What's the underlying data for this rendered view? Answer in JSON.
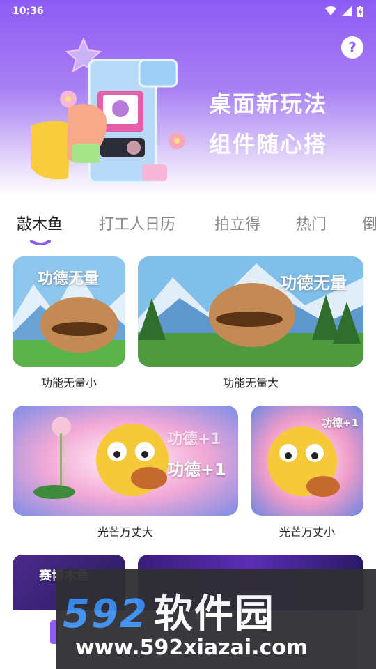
{
  "status_bar": {
    "time": "10:36"
  },
  "hero": {
    "line1": "桌面新玩法",
    "line2": "组件随心搭",
    "help": "?"
  },
  "tabs": [
    {
      "label": "敲木鱼",
      "active": true
    },
    {
      "label": "打工人日历"
    },
    {
      "label": "拍立得"
    },
    {
      "label": "热门"
    },
    {
      "label": "倒"
    }
  ],
  "cards": [
    {
      "caption": "功能无量小",
      "overlay": "功德无量"
    },
    {
      "caption": "功能无量大",
      "overlay": "功德无量"
    },
    {
      "caption": "光芒万丈大",
      "overlay_top": "功德+1",
      "overlay_main": "功德+1"
    },
    {
      "caption": "光芒万丈小",
      "overlay": "功德+1"
    }
  ],
  "bottom_tiles": [
    {
      "text": "赛博木鱼"
    }
  ],
  "watermark": {
    "digits": "592",
    "name": "软件园",
    "url": "www.592xiazai.com"
  },
  "colors": {
    "accent": "#8e5cf5",
    "tab_inactive": "#8a8a8a"
  }
}
